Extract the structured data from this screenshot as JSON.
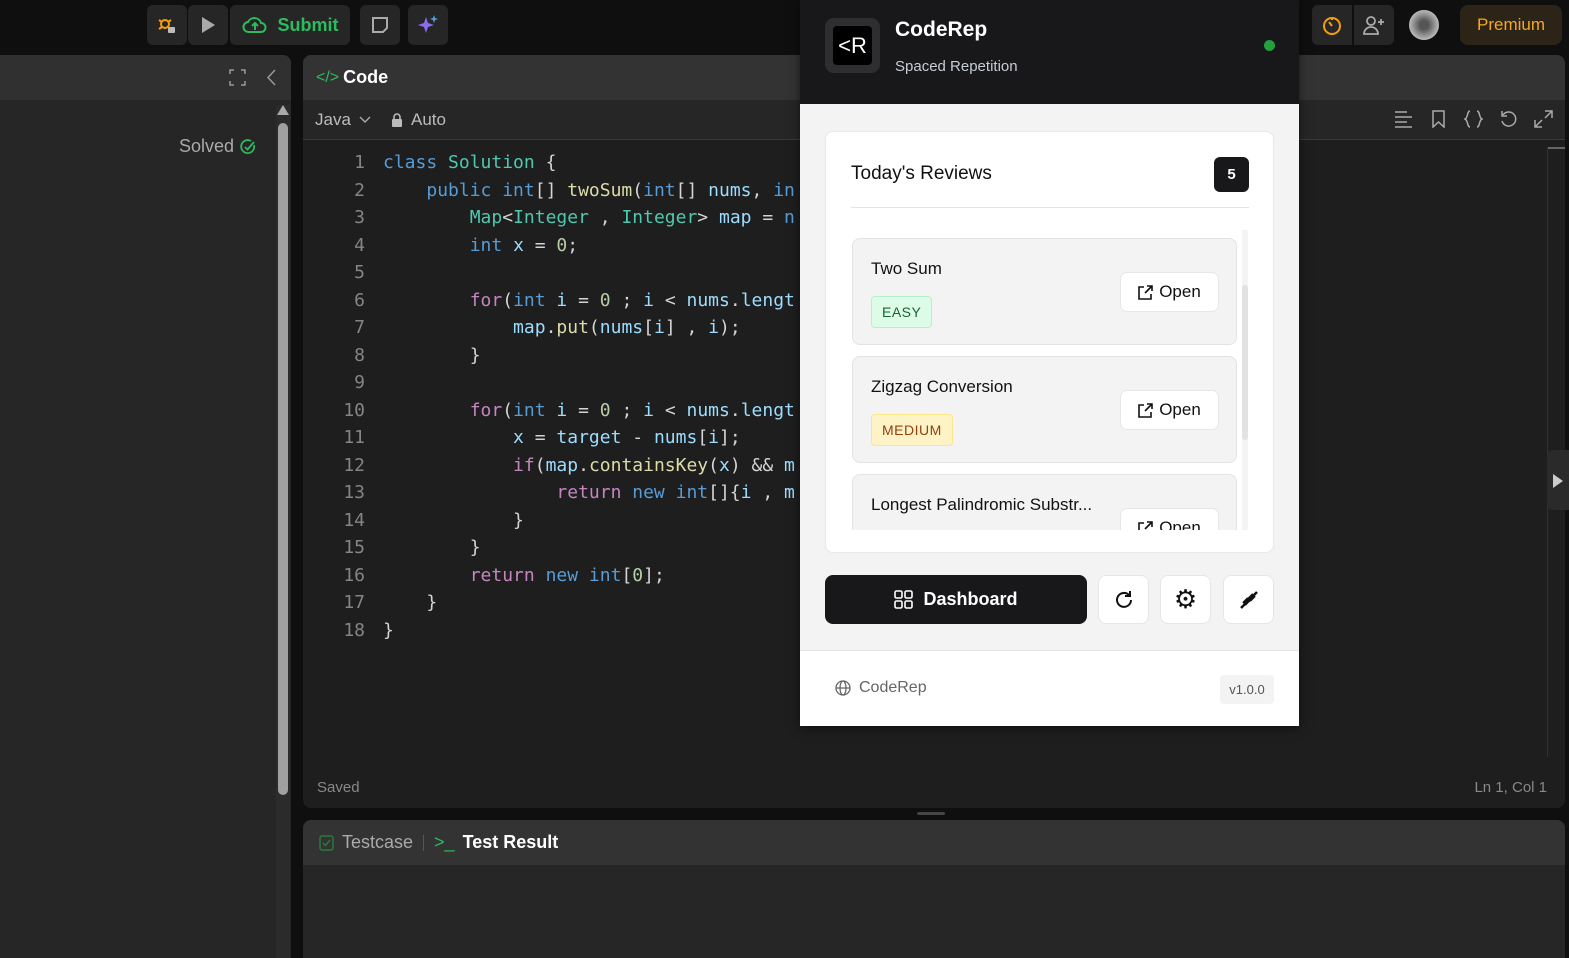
{
  "topbar": {
    "submit_label": "Submit",
    "premium_label": "Premium"
  },
  "left_panel": {
    "status": "Solved"
  },
  "editor": {
    "tab_label": "Code",
    "language": "Java",
    "mode": "Auto",
    "status_left": "Saved",
    "status_right": "Ln 1, Col 1",
    "lines": [
      [
        [
          "class ",
          "kw"
        ],
        [
          "Solution",
          "ty"
        ],
        [
          " {",
          ""
        ]
      ],
      [
        [
          "    ",
          ""
        ],
        [
          "public ",
          "kw"
        ],
        [
          "int",
          "kw"
        ],
        [
          "[] ",
          ""
        ],
        [
          "twoSum",
          "fn"
        ],
        [
          "(",
          ""
        ],
        [
          "int",
          "kw"
        ],
        [
          "[] ",
          ""
        ],
        [
          "nums",
          "var"
        ],
        [
          ", ",
          ""
        ],
        [
          "in",
          "kw"
        ]
      ],
      [
        [
          "        ",
          ""
        ],
        [
          "Map",
          "ty"
        ],
        [
          "<",
          ""
        ],
        [
          "Integer",
          "ty"
        ],
        [
          " , ",
          ""
        ],
        [
          "Integer",
          "ty"
        ],
        [
          "> ",
          ""
        ],
        [
          "map",
          "var"
        ],
        [
          " = ",
          ""
        ],
        [
          "n",
          "kw"
        ]
      ],
      [
        [
          "        ",
          ""
        ],
        [
          "int ",
          "kw"
        ],
        [
          "x",
          "var"
        ],
        [
          " = ",
          ""
        ],
        [
          "0",
          "num"
        ],
        [
          ";",
          ""
        ]
      ],
      [
        [
          "",
          ""
        ]
      ],
      [
        [
          "        ",
          ""
        ],
        [
          "for",
          "ctl"
        ],
        [
          "(",
          ""
        ],
        [
          "int ",
          "kw"
        ],
        [
          "i",
          "var"
        ],
        [
          " = ",
          ""
        ],
        [
          "0",
          "num"
        ],
        [
          " ; ",
          ""
        ],
        [
          "i",
          "var"
        ],
        [
          " < ",
          ""
        ],
        [
          "nums",
          "var"
        ],
        [
          ".",
          ""
        ],
        [
          "lengt",
          "var"
        ]
      ],
      [
        [
          "            ",
          ""
        ],
        [
          "map",
          "var"
        ],
        [
          ".",
          ""
        ],
        [
          "put",
          "fn"
        ],
        [
          "(",
          ""
        ],
        [
          "nums",
          "var"
        ],
        [
          "[",
          ""
        ],
        [
          "i",
          "var"
        ],
        [
          "] , ",
          ""
        ],
        [
          "i",
          "var"
        ],
        [
          ");",
          ""
        ]
      ],
      [
        [
          "        }",
          ""
        ]
      ],
      [
        [
          "",
          ""
        ]
      ],
      [
        [
          "        ",
          ""
        ],
        [
          "for",
          "ctl"
        ],
        [
          "(",
          ""
        ],
        [
          "int ",
          "kw"
        ],
        [
          "i",
          "var"
        ],
        [
          " = ",
          ""
        ],
        [
          "0",
          "num"
        ],
        [
          " ; ",
          ""
        ],
        [
          "i",
          "var"
        ],
        [
          " < ",
          ""
        ],
        [
          "nums",
          "var"
        ],
        [
          ".",
          ""
        ],
        [
          "lengt",
          "var"
        ]
      ],
      [
        [
          "            ",
          ""
        ],
        [
          "x",
          "var"
        ],
        [
          " = ",
          ""
        ],
        [
          "target",
          "var"
        ],
        [
          " - ",
          ""
        ],
        [
          "nums",
          "var"
        ],
        [
          "[",
          ""
        ],
        [
          "i",
          "var"
        ],
        [
          "];",
          ""
        ]
      ],
      [
        [
          "            ",
          ""
        ],
        [
          "if",
          "ctl"
        ],
        [
          "(",
          ""
        ],
        [
          "map",
          "var"
        ],
        [
          ".",
          ""
        ],
        [
          "containsKey",
          "fn"
        ],
        [
          "(",
          ""
        ],
        [
          "x",
          "var"
        ],
        [
          ") && ",
          ""
        ],
        [
          "m",
          "var"
        ]
      ],
      [
        [
          "                ",
          ""
        ],
        [
          "return ",
          "ctl"
        ],
        [
          "new ",
          "kw"
        ],
        [
          "int",
          "kw"
        ],
        [
          "[]{",
          ""
        ],
        [
          "i",
          "var"
        ],
        [
          " , ",
          ""
        ],
        [
          "m",
          "var"
        ]
      ],
      [
        [
          "            }",
          ""
        ]
      ],
      [
        [
          "        }",
          ""
        ]
      ],
      [
        [
          "        ",
          ""
        ],
        [
          "return ",
          "ctl"
        ],
        [
          "new ",
          "kw"
        ],
        [
          "int",
          "kw"
        ],
        [
          "[",
          ""
        ],
        [
          "0",
          "num"
        ],
        [
          "];",
          ""
        ]
      ],
      [
        [
          "    }",
          ""
        ]
      ],
      [
        [
          "}",
          ""
        ]
      ]
    ]
  },
  "bottom": {
    "tab_testcase": "Testcase",
    "tab_result": "Test Result"
  },
  "popup": {
    "title": "CodeRep",
    "subtitle": "Spaced Repetition",
    "status_color": "#22a03c",
    "reviews_title": "Today's Reviews",
    "reviews_count": "5",
    "items": [
      {
        "title": "Two Sum",
        "difficulty": "EASY",
        "open": "Open"
      },
      {
        "title": "Zigzag Conversion",
        "difficulty": "MEDIUM",
        "open": "Open"
      },
      {
        "title": "Longest Palindromic Substr...",
        "difficulty": "",
        "open": "Open"
      }
    ],
    "dashboard_label": "Dashboard",
    "footer_brand": "CodeRep",
    "version": "v1.0.0"
  }
}
